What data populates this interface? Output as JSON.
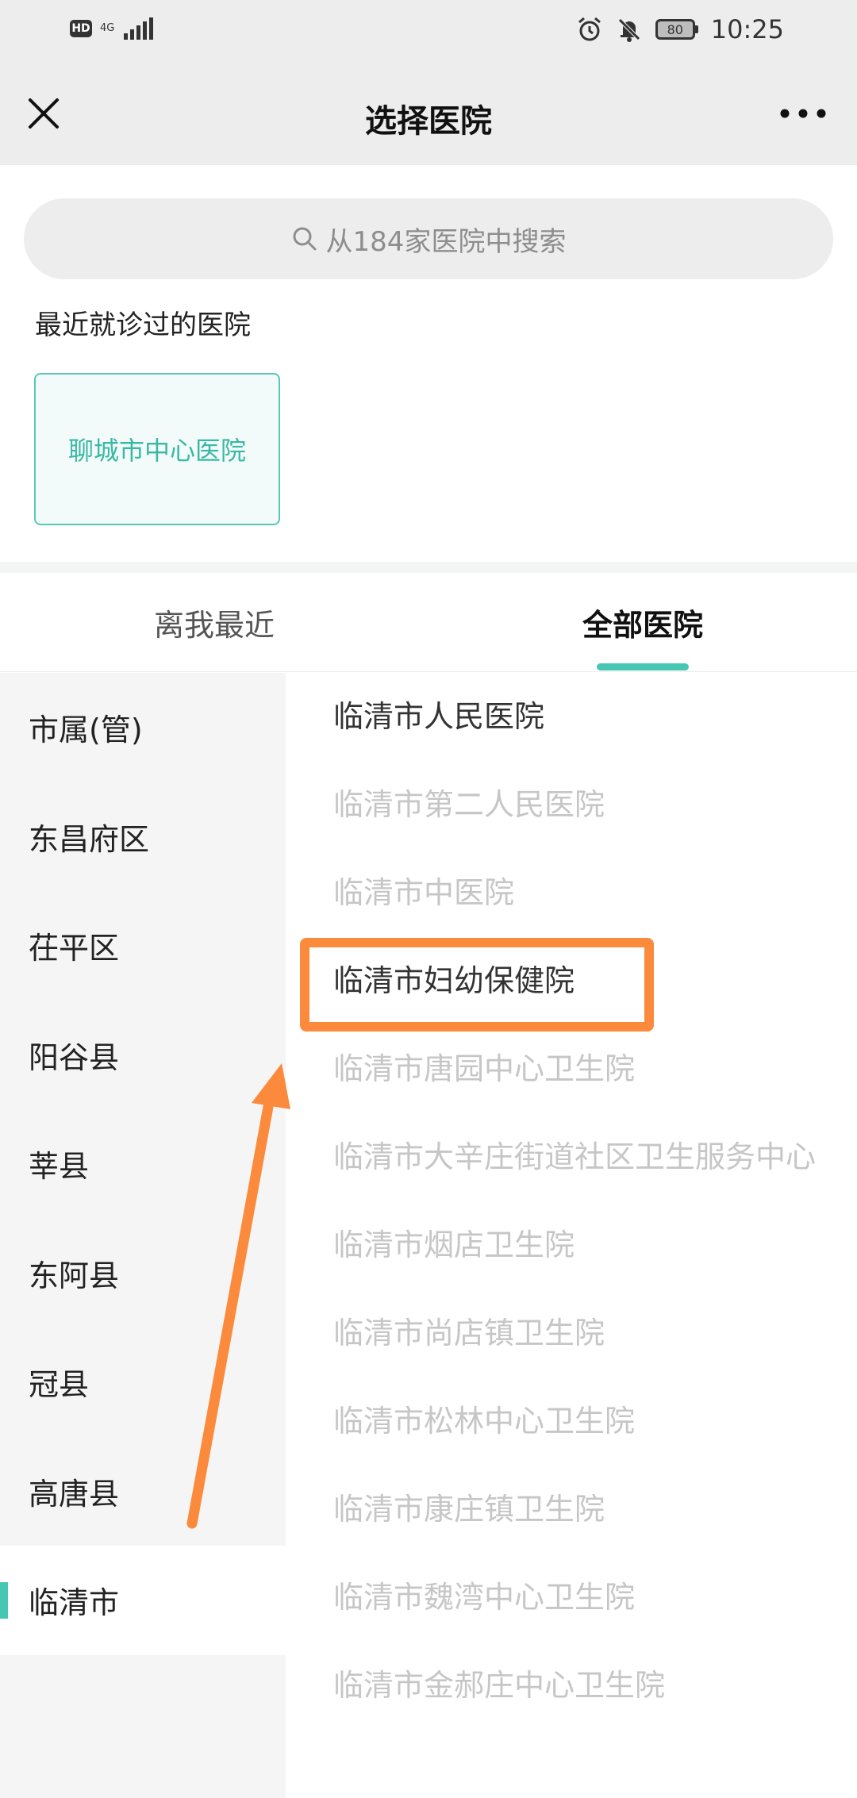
{
  "status_bar": {
    "hd": "HD",
    "network": "4G",
    "battery": "80",
    "time": "10:25"
  },
  "nav": {
    "title": "选择医院"
  },
  "search": {
    "placeholder": "从184家医院中搜索"
  },
  "recent": {
    "label": "最近就诊过的医院",
    "hospitals": [
      "聊城市中心医院"
    ]
  },
  "tabs": [
    {
      "label": "离我最近",
      "selected": false
    },
    {
      "label": "全部医院",
      "selected": true
    }
  ],
  "regions": [
    {
      "label": "市属(管)"
    },
    {
      "label": "东昌府区"
    },
    {
      "label": "茌平区"
    },
    {
      "label": "阳谷县"
    },
    {
      "label": "莘县"
    },
    {
      "label": "东阿县"
    },
    {
      "label": "冠县"
    },
    {
      "label": "高唐县"
    },
    {
      "label": "临清市",
      "selected": true
    }
  ],
  "hospitals": [
    {
      "name": "临清市人民医院",
      "enabled": true
    },
    {
      "name": "临清市第二人民医院",
      "enabled": false
    },
    {
      "name": "临清市中医院",
      "enabled": false
    },
    {
      "name": "临清市妇幼保健院",
      "enabled": true
    },
    {
      "name": "临清市唐园中心卫生院",
      "enabled": false
    },
    {
      "name": "临清市大辛庄街道社区卫生服务中心",
      "enabled": false
    },
    {
      "name": "临清市烟店卫生院",
      "enabled": false
    },
    {
      "name": "临清市尚店镇卫生院",
      "enabled": false
    },
    {
      "name": "临清市松林中心卫生院",
      "enabled": false
    },
    {
      "name": "临清市康庄镇卫生院",
      "enabled": false
    },
    {
      "name": "临清市魏湾中心卫生院",
      "enabled": false
    },
    {
      "name": "临清市金郝庄中心卫生院",
      "enabled": false
    }
  ],
  "colors": {
    "accent": "#47c7b3",
    "annotation": "#fb8a3c"
  }
}
